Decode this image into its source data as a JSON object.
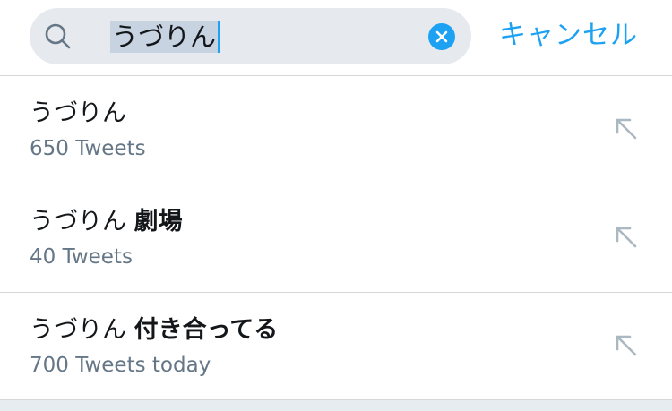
{
  "search": {
    "query": "うづりん",
    "cancel_label": "キャンセル"
  },
  "suggestions": [
    {
      "title_prefix": "うづりん",
      "title_bold": "",
      "subtitle": "650 Tweets"
    },
    {
      "title_prefix": "うづりん ",
      "title_bold": "劇場",
      "subtitle": "40 Tweets"
    },
    {
      "title_prefix": "うづりん ",
      "title_bold": "付き合ってる",
      "subtitle": "700 Tweets today"
    }
  ],
  "colors": {
    "accent": "#1da1f2",
    "search_bg": "#e6e9ee",
    "subtitle": "#657786",
    "text": "#14171a"
  },
  "icons": {
    "search": "search-icon",
    "clear": "clear-icon",
    "fill_query": "arrow-up-left-icon"
  }
}
